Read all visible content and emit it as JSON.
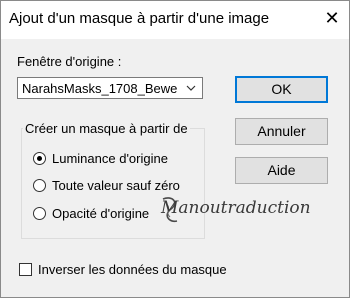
{
  "dialog": {
    "title": "Ajout d'un masque à partir d'une image",
    "close_symbol": "✕"
  },
  "source": {
    "label": "Fenêtre d'origine :",
    "selected_value": "NarahsMasks_1708_Bewe",
    "dropdown_icon": "chevron-down-icon"
  },
  "create_group": {
    "legend": "Créer un masque à partir de",
    "options": [
      {
        "label": "Luminance d'origine",
        "checked": true
      },
      {
        "label": "Toute valeur sauf zéro",
        "checked": false
      },
      {
        "label": "Opacité d'origine",
        "checked": false
      }
    ]
  },
  "invert": {
    "label": "Inverser les données du masque",
    "checked": false
  },
  "buttons": {
    "ok": "OK",
    "cancel": "Annuler",
    "help": "Aide"
  },
  "watermark": {
    "text": "Manoutraduction"
  },
  "colors": {
    "focus_border": "#0078d7",
    "dialog_bg": "#f0f0f0",
    "title_bg": "#ffffff"
  }
}
